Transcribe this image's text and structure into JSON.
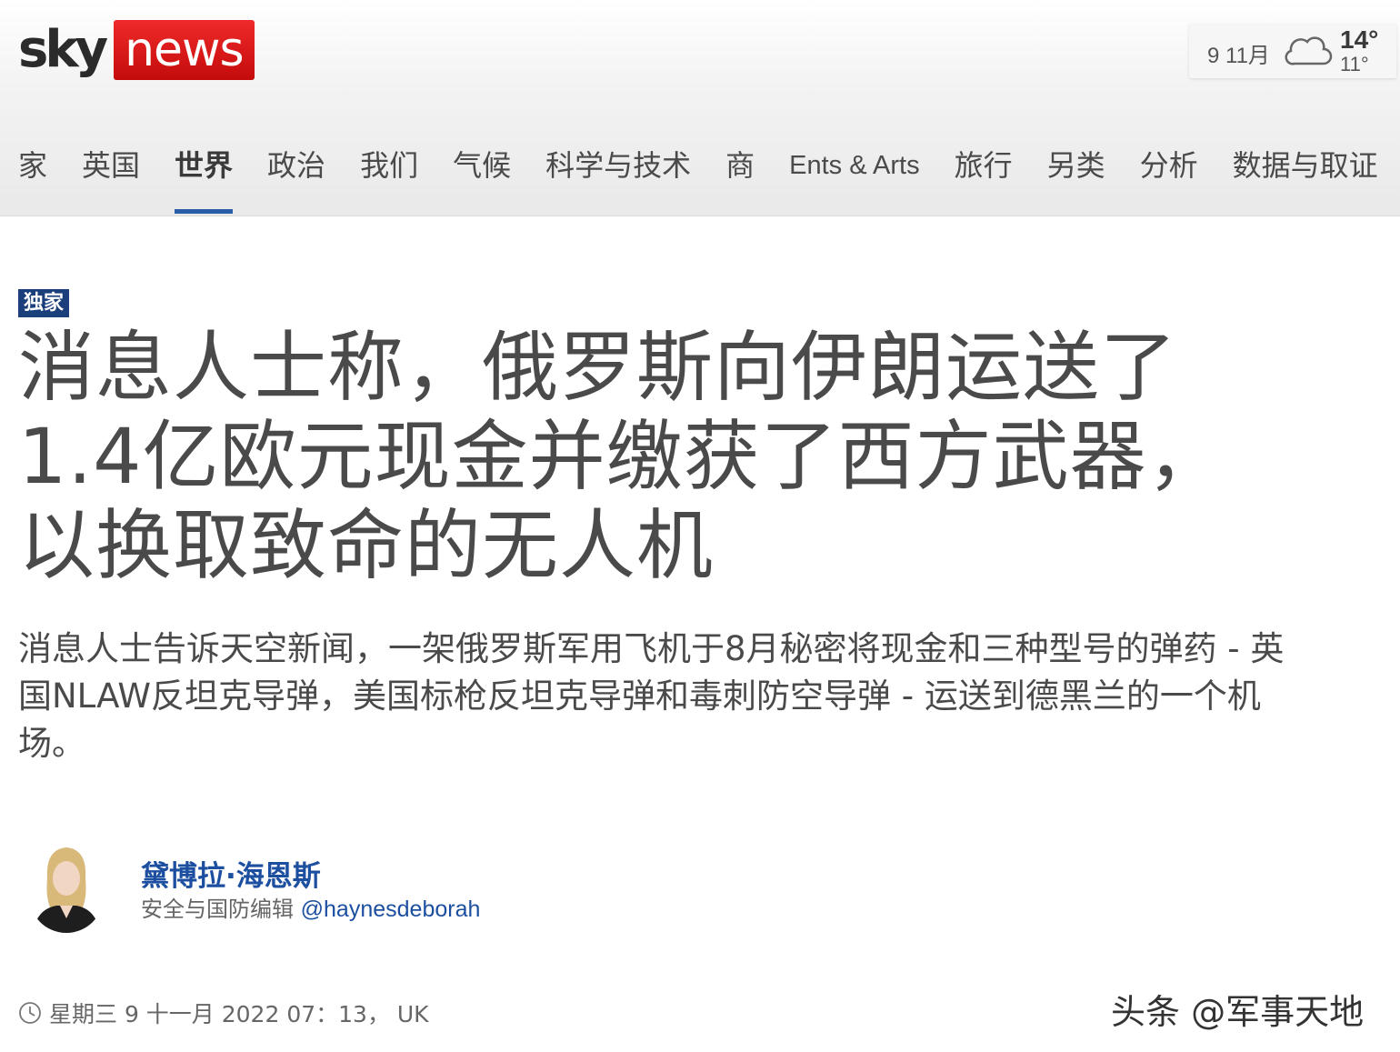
{
  "header": {
    "logo": {
      "sky": "sky",
      "news": "news"
    },
    "weather": {
      "date": "9 11月",
      "icon": "cloud-icon",
      "high": "14°",
      "low": "11°"
    }
  },
  "nav": {
    "items": [
      {
        "label": "家",
        "active": false
      },
      {
        "label": "英国",
        "active": false
      },
      {
        "label": "世界",
        "active": true
      },
      {
        "label": "政治",
        "active": false
      },
      {
        "label": "我们",
        "active": false
      },
      {
        "label": "气候",
        "active": false
      },
      {
        "label": "科学与技术",
        "active": false
      },
      {
        "label": "商",
        "active": false
      },
      {
        "label": "Ents & Arts",
        "active": false
      },
      {
        "label": "旅行",
        "active": false
      },
      {
        "label": "另类",
        "active": false
      },
      {
        "label": "分析",
        "active": false
      },
      {
        "label": "数据与取证",
        "active": false
      }
    ],
    "accent_color": "#2a5da8"
  },
  "article": {
    "badge": "独家",
    "headline": "消息人士称，俄罗斯向伊朗运送了1.4亿欧元现金并缴获了西方武器，以换取致命的无人机",
    "standfirst": "消息人士告诉天空新闻，一架俄罗斯军用飞机于8月秘密将现金和三种型号的弹药 - 英国NLAW反坦克导弹，美国标枪反坦克导弹和毒刺防空导弹 - 运送到德黑兰的一个机场。",
    "author": {
      "name": "黛博拉·海恩斯",
      "role": "安全与国防编辑",
      "handle": "@haynesdeborah"
    },
    "dateline": "星期三 9 十一月 2022 07：13， UK"
  },
  "watermark": "头条 @军事天地"
}
